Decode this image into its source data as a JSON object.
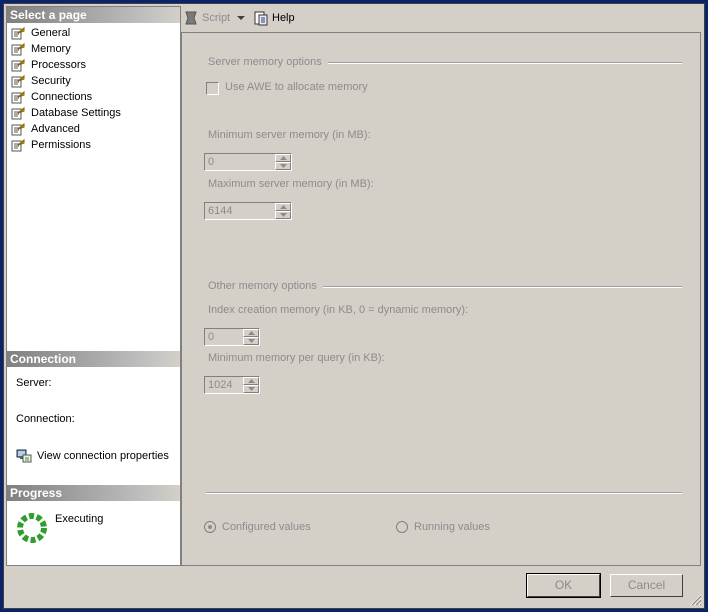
{
  "sidebar": {
    "select_page_header": "Select a page",
    "pages": [
      {
        "label": "General",
        "icon": "page-icon"
      },
      {
        "label": "Memory",
        "icon": "page-icon"
      },
      {
        "label": "Processors",
        "icon": "page-icon"
      },
      {
        "label": "Security",
        "icon": "page-icon"
      },
      {
        "label": "Connections",
        "icon": "page-icon"
      },
      {
        "label": "Database Settings",
        "icon": "page-icon"
      },
      {
        "label": "Advanced",
        "icon": "page-icon"
      },
      {
        "label": "Permissions",
        "icon": "page-icon"
      }
    ],
    "connection_header": "Connection",
    "server_label": "Server:",
    "connection_label": "Connection:",
    "view_connection_link": "View connection properties",
    "progress_header": "Progress",
    "progress_status": "Executing"
  },
  "toolbar": {
    "script_label": "Script",
    "help_label": "Help"
  },
  "memory": {
    "server_options_title": "Server memory options",
    "use_awe_label": "Use AWE to allocate memory",
    "use_awe_checked": false,
    "min_server_label": "Minimum server memory (in MB):",
    "min_server_value": "0",
    "max_server_label": "Maximum server memory (in MB):",
    "max_server_value": "6144",
    "other_options_title": "Other memory options",
    "index_creation_label": "Index creation memory (in KB, 0 = dynamic memory):",
    "index_creation_value": "0",
    "min_query_label": "Minimum memory per query (in KB):",
    "min_query_value": "1024",
    "configured_label": "Configured values",
    "running_label": "Running values",
    "selected_values": "Configured values"
  },
  "footer": {
    "ok_label": "OK",
    "cancel_label": "Cancel"
  },
  "colors": {
    "window_bg": "#d4d0c8",
    "disabled_text": "#8c8c8c",
    "header_gradient_start": "#808080",
    "progress_green": "#2e9e2e"
  }
}
